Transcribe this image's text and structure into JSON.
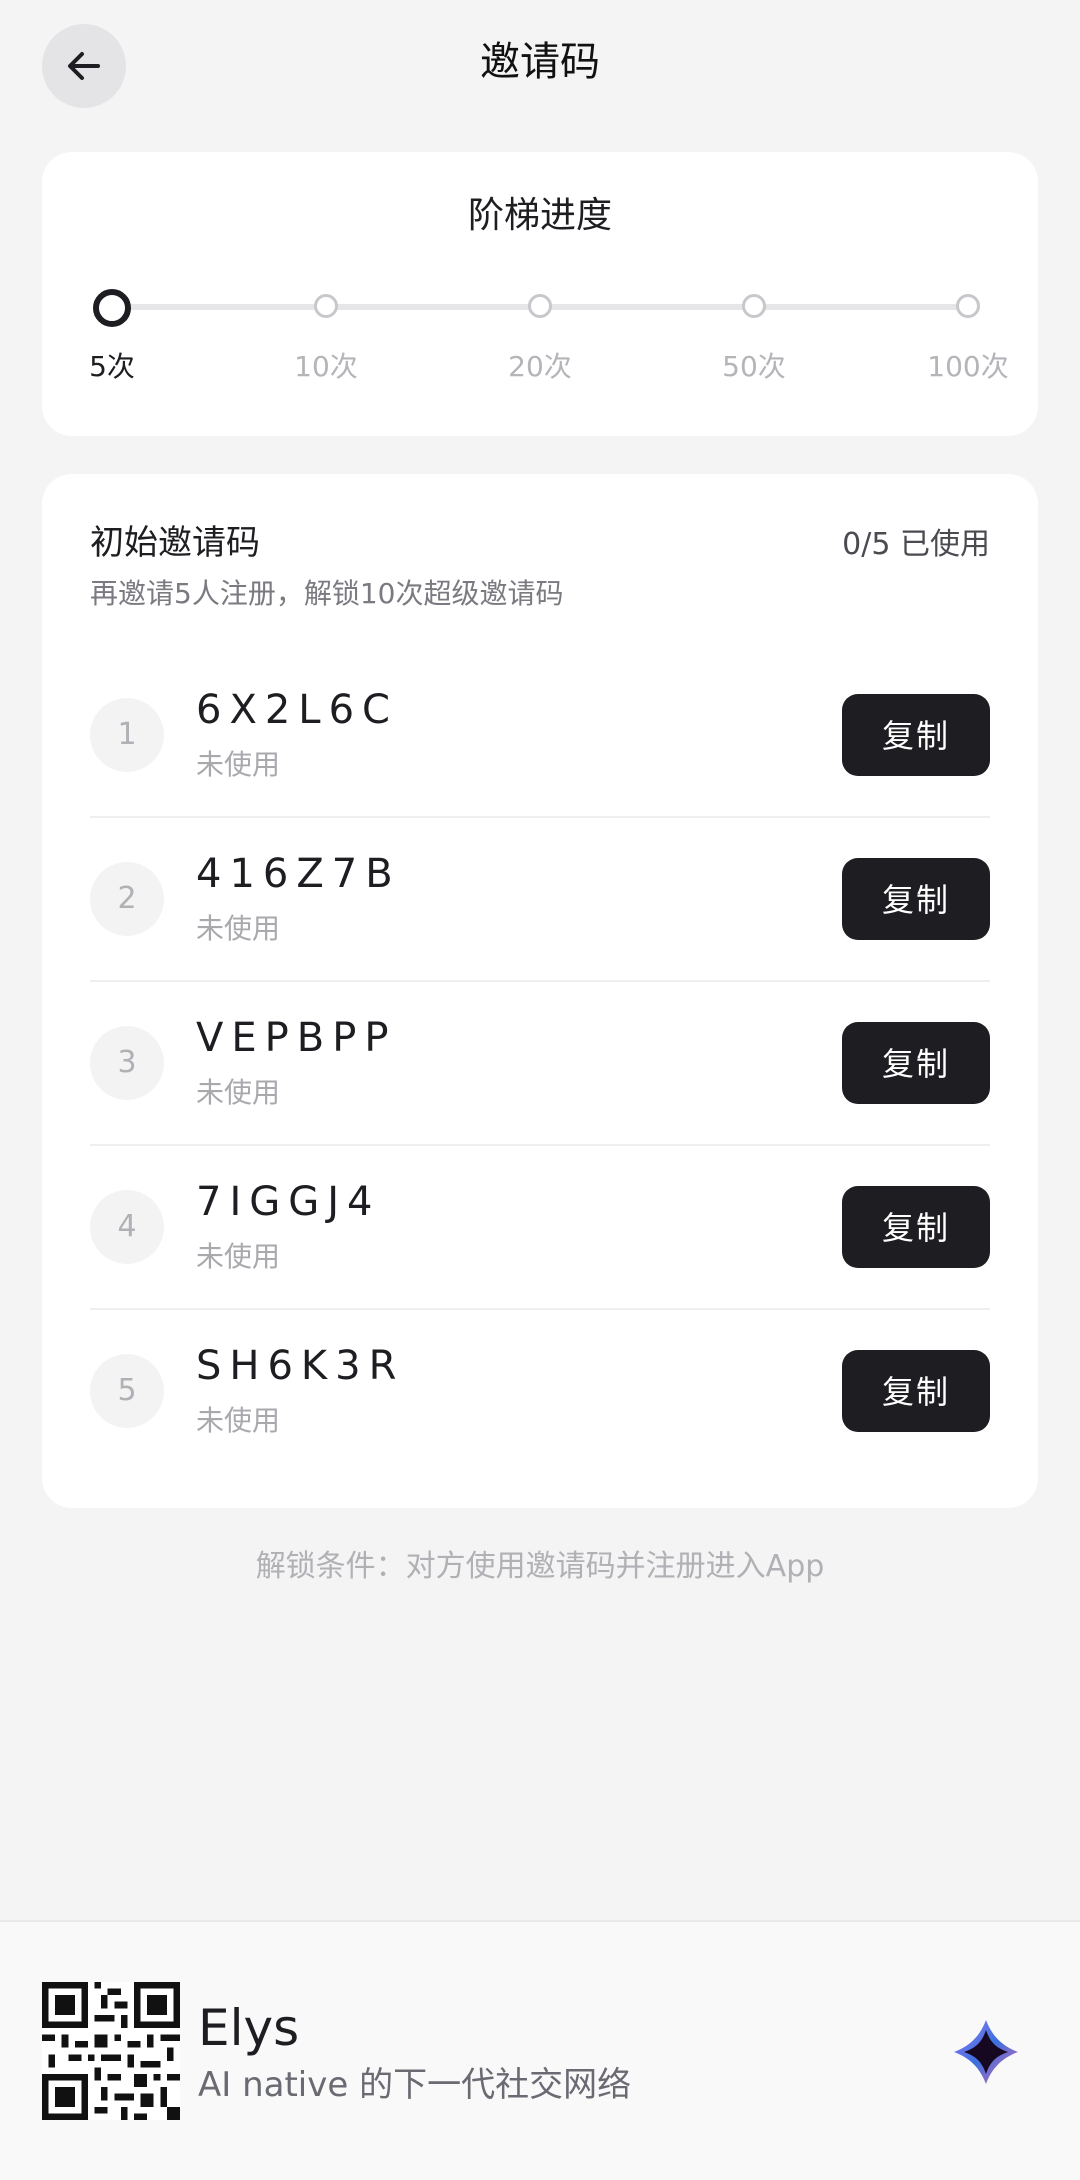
{
  "header": {
    "title": "邀请码",
    "back_icon": "arrow-left-icon"
  },
  "progress": {
    "title": "阶梯进度",
    "steps": [
      {
        "label": "5次",
        "active": true
      },
      {
        "label": "10次",
        "active": false
      },
      {
        "label": "20次",
        "active": false
      },
      {
        "label": "50次",
        "active": false
      },
      {
        "label": "100次",
        "active": false
      }
    ]
  },
  "codes": {
    "title": "初始邀请码",
    "usage": "0/5 已使用",
    "subtitle": "再邀请5人注册，解锁10次超级邀请码",
    "items": [
      {
        "index": "1",
        "code": "6X2L6C",
        "status": "未使用",
        "copy_label": "复制"
      },
      {
        "index": "2",
        "code": "416Z7B",
        "status": "未使用",
        "copy_label": "复制"
      },
      {
        "index": "3",
        "code": "VEPBPP",
        "status": "未使用",
        "copy_label": "复制"
      },
      {
        "index": "4",
        "code": "7IGGJ4",
        "status": "未使用",
        "copy_label": "复制"
      },
      {
        "index": "5",
        "code": "SH6K3R",
        "status": "未使用",
        "copy_label": "复制"
      }
    ]
  },
  "unlock_note": "解锁条件：对方使用邀请码并注册进入App",
  "footer": {
    "brand_name": "Elys",
    "tagline": "AI native 的下一代社交网络",
    "qr_icon": "qr-code-icon",
    "logo_icon": "elys-logo-icon"
  },
  "colors": {
    "background": "#f4f4f5",
    "card": "#ffffff",
    "button": "#1e1e22",
    "muted": "#b0b0b5"
  }
}
